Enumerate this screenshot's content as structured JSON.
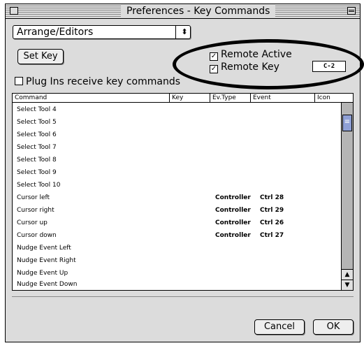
{
  "window": {
    "title": "Preferences - Key Commands"
  },
  "category_dropdown": {
    "value": "Arrange/Editors",
    "arrow": "⬍"
  },
  "set_key_button": {
    "label": "Set Key"
  },
  "plugins_checkbox": {
    "label": "Plug Ins receive key commands",
    "checked": false
  },
  "remote_active": {
    "label": "Remote Active",
    "checked": true
  },
  "remote_key": {
    "label": "Remote Key",
    "checked": true,
    "value": "C-2"
  },
  "table": {
    "headers": [
      "Command",
      "Key",
      "Ev.Type",
      "Event",
      "Icon"
    ],
    "rows": [
      {
        "command": "Select Tool 4",
        "ev_type": "",
        "event": ""
      },
      {
        "command": "Select Tool 5",
        "ev_type": "",
        "event": ""
      },
      {
        "command": "Select Tool 6",
        "ev_type": "",
        "event": ""
      },
      {
        "command": "Select Tool 7",
        "ev_type": "",
        "event": ""
      },
      {
        "command": "Select Tool 8",
        "ev_type": "",
        "event": ""
      },
      {
        "command": "Select Tool 9",
        "ev_type": "",
        "event": ""
      },
      {
        "command": "Select Tool 10",
        "ev_type": "",
        "event": ""
      },
      {
        "command": "Cursor left",
        "ev_type": "Controller",
        "event": "Ctrl 28"
      },
      {
        "command": "Cursor right",
        "ev_type": "Controller",
        "event": "Ctrl 29"
      },
      {
        "command": "Cursor up",
        "ev_type": "Controller",
        "event": "Ctrl 26"
      },
      {
        "command": "Cursor down",
        "ev_type": "Controller",
        "event": "Ctrl 27"
      },
      {
        "command": "Nudge Event Left",
        "ev_type": "",
        "event": ""
      },
      {
        "command": "Nudge Event Right",
        "ev_type": "",
        "event": ""
      },
      {
        "command": "Nudge Event Up",
        "ev_type": "",
        "event": ""
      },
      {
        "command": "Nudge Event Down",
        "ev_type": "",
        "event": ""
      }
    ]
  },
  "scroll": {
    "up_arrow": "▲",
    "down_arrow": "▼",
    "thumb_glyph": "≡"
  },
  "buttons": {
    "cancel": "Cancel",
    "ok": "OK"
  }
}
